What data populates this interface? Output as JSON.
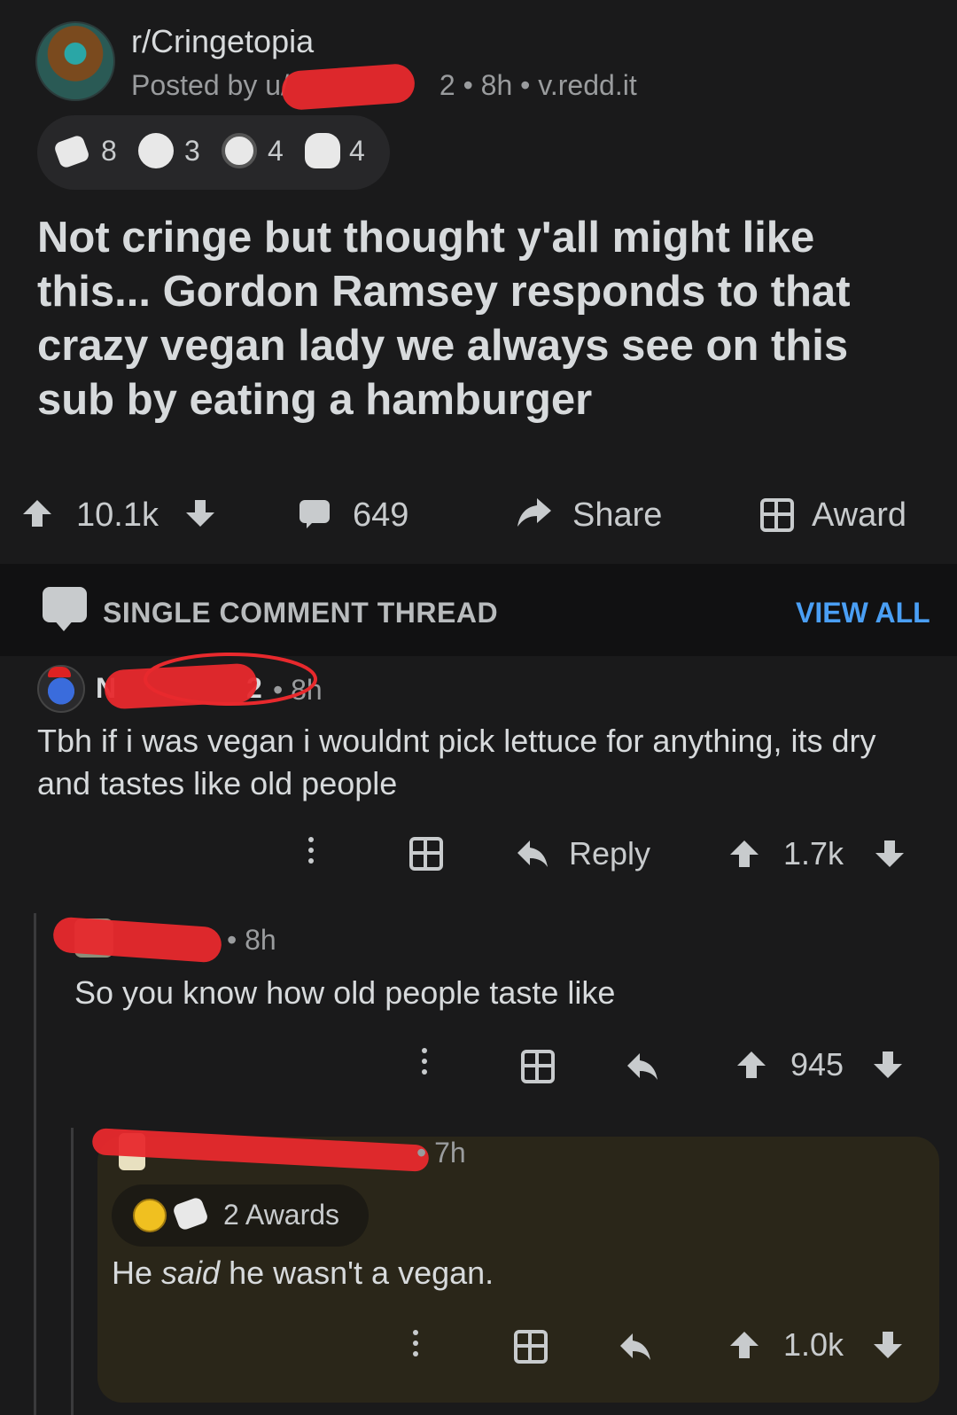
{
  "post": {
    "subreddit": "r/Cringetopia",
    "posted_by": "Posted by u/",
    "meta_tail": "2 • 8h • v.redd.it",
    "awards": [
      {
        "icon": "wholesome-seal-icon",
        "count": "8"
      },
      {
        "icon": "ghost-face-icon",
        "count": "3"
      },
      {
        "icon": "silver-coin-icon",
        "count": "4"
      },
      {
        "icon": "polar-bear-icon",
        "count": "4"
      }
    ],
    "title": "Not cringe but thought y'all might like this... Gordon Ramsey responds to that crazy vegan lady we always see on this sub by eating a hamburger",
    "votes": "10.1k",
    "comments": "649",
    "share_label": "Share",
    "award_label": "Award"
  },
  "thread": {
    "label": "SINGLE COMMENT THREAD",
    "view_all": "VIEW ALL"
  },
  "comments": [
    {
      "username_visible": "N",
      "username_tail": "2",
      "time": "• 8h",
      "text": "Tbh if i was vegan i wouldnt pick lettuce for anything, its dry and tastes like old people",
      "reply_label": "Reply",
      "votes": "1.7k"
    },
    {
      "time": "• 8h",
      "text": "So you know how old people taste like",
      "votes": "945"
    },
    {
      "time": "• 7h",
      "awards_label": "2 Awards",
      "text_before": "He ",
      "text_em": "said",
      "text_after": " he wasn't a vegan.",
      "votes": "1.0k"
    }
  ],
  "colors": {
    "background": "#1a1a1b",
    "thread_bar": "#111112",
    "accent_blue": "#4a9ff5",
    "redaction": "#e8292d",
    "highlight": "#2a2619"
  }
}
